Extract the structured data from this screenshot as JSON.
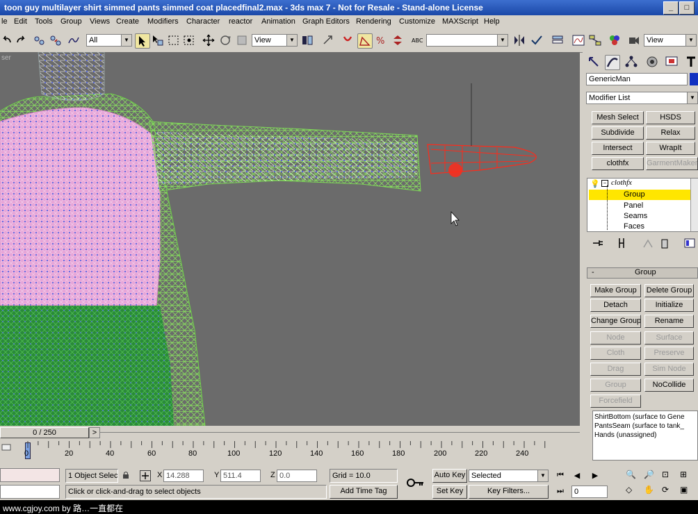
{
  "window": {
    "title": "toon guy multilayer shirt simmed pants simmed coat placedfinal2.max - 3ds max 7   - Not for Resale - Stand-alone License",
    "min_label": "_",
    "max_label": "□"
  },
  "menu": [
    "le",
    "Edit",
    "Tools",
    "Group",
    "Views",
    "Create",
    "Modifiers",
    "Character",
    "reactor",
    "Animation",
    "Graph Editors",
    "Rendering",
    "Customize",
    "MAXScript",
    "Help"
  ],
  "toolbar": {
    "selection_filter": "All",
    "ref_coord": "View",
    "named_selection": "",
    "render_view": "View"
  },
  "viewport": {
    "label": "ser"
  },
  "command_panel": {
    "object_name": "GenericMan",
    "modifier_list": "Modifier List",
    "modifier_buttons": [
      "Mesh Select",
      "HSDS",
      "Subdivide",
      "Relax",
      "Intersect",
      "WrapIt",
      "clothfx",
      "GarmentMaker"
    ],
    "stack": {
      "top": "clothfx",
      "items": [
        "Group",
        "Panel",
        "Seams",
        "Faces"
      ],
      "selected": "Group"
    },
    "rollout_title": "Group",
    "rollout_collapse": "-",
    "group_buttons": [
      {
        "label": "Make Group",
        "enabled": true
      },
      {
        "label": "Delete Group",
        "enabled": true
      },
      {
        "label": "Detach",
        "enabled": true
      },
      {
        "label": "Initialize",
        "enabled": true
      },
      {
        "label": "Change Group",
        "enabled": true
      },
      {
        "label": "Rename",
        "enabled": true
      },
      {
        "label": "Node",
        "enabled": false
      },
      {
        "label": "Surface",
        "enabled": false
      },
      {
        "label": "Cloth",
        "enabled": false
      },
      {
        "label": "Preserve",
        "enabled": false
      },
      {
        "label": "Drag",
        "enabled": false
      },
      {
        "label": "Sim Node",
        "enabled": false
      },
      {
        "label": "Group",
        "enabled": false
      },
      {
        "label": "NoCollide",
        "enabled": true
      },
      {
        "label": "Forcefield",
        "enabled": false
      }
    ],
    "group_list": [
      "ShirtBottom (surface to Gene",
      "PantsSeam (surface to tank_",
      "Hands (unassigned)"
    ]
  },
  "timeline": {
    "frame_display": "0 / 250",
    "next_label": ">",
    "prev_label": "<",
    "ticks": [
      "0",
      "20",
      "40",
      "60",
      "80",
      "100",
      "120",
      "140",
      "160",
      "180",
      "200",
      "220",
      "240"
    ]
  },
  "status": {
    "selection": "1 Object Selec",
    "x_label": "X",
    "x_value": "14.288",
    "y_label": "Y",
    "y_value": "511.4",
    "z_label": "Z",
    "z_value": "0.0",
    "grid": "Grid = 10.0",
    "prompt": "Click or click-and-drag to select objects",
    "add_time_tag": "Add Time Tag",
    "auto_key": "Auto Key",
    "set_key": "Set Key",
    "key_mode": "Selected",
    "key_filters": "Key Filters...",
    "frame": "0"
  },
  "watermark": "www.cgjoy.com by 路…一直都在",
  "colors": {
    "viewport_bg": "#6b6b6b",
    "mesh_green": "#7ed957",
    "mesh_pink": "#e7a6d8",
    "mesh_blue": "#3a4fe0",
    "selection_red": "#ff2a1a",
    "stack_highlight": "#ffe600"
  }
}
